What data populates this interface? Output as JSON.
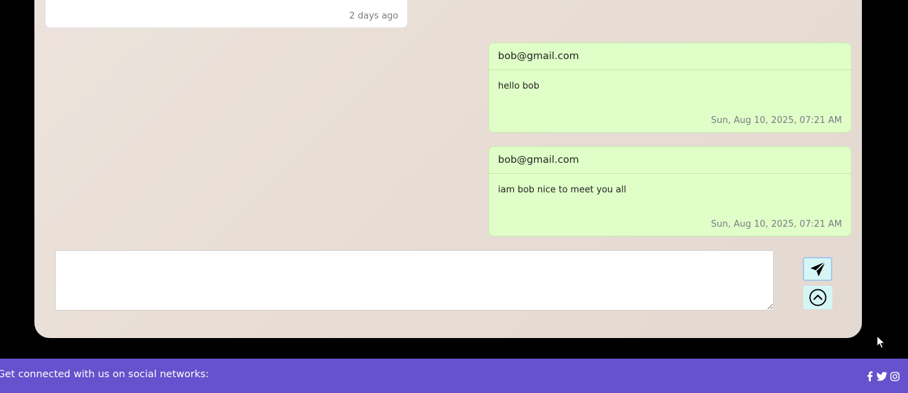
{
  "messages": [
    {
      "type": "incoming",
      "time": "2 days ago"
    },
    {
      "type": "outgoing",
      "sender": "bob@gmail.com",
      "text": "hello bob",
      "time": "Sun, Aug 10, 2025, 07:21 AM"
    },
    {
      "type": "outgoing",
      "sender": "bob@gmail.com",
      "text": "iam bob nice to meet you all",
      "time": "Sun, Aug 10, 2025, 07:21 AM"
    }
  ],
  "composer": {
    "value": "",
    "send_icon": "paper-plane-icon",
    "scroll_icon": "circle-chevron-up-icon"
  },
  "footer": {
    "tagline": "Get connected with us on social networks:",
    "socials": [
      "facebook-icon",
      "twitter-icon",
      "instagram-icon"
    ],
    "background": "#6552cc"
  },
  "colors": {
    "outgoing_bubble": "#e0ffc8",
    "incoming_bubble": "#ffffff",
    "button_bg": "#d6f6f6"
  }
}
